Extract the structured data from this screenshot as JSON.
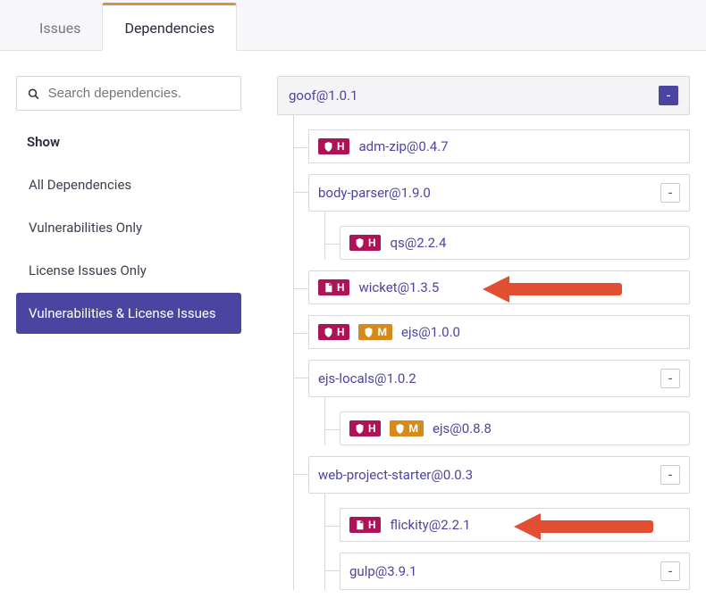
{
  "tabs": {
    "issues": "Issues",
    "dependencies": "Dependencies",
    "active": "dependencies"
  },
  "search": {
    "placeholder": "Search dependencies."
  },
  "filters": {
    "heading": "Show",
    "items": [
      {
        "id": "all",
        "label": "All Dependencies"
      },
      {
        "id": "vuln",
        "label": "Vulnerabilities Only"
      },
      {
        "id": "lic",
        "label": "License Issues Only"
      },
      {
        "id": "both",
        "label": "Vulnerabilities & License Issues"
      }
    ],
    "active": "both"
  },
  "tree": {
    "root": {
      "label": "goof@1.0.1",
      "collapse": "-"
    },
    "c": [
      {
        "label": "adm-zip@0.4.7",
        "badges": [
          {
            "icon": "shield",
            "sev": "H",
            "cls": "high"
          }
        ]
      },
      {
        "label": "body-parser@1.9.0",
        "collapse": "-",
        "c": [
          {
            "label": "qs@2.2.4",
            "badges": [
              {
                "icon": "shield",
                "sev": "H",
                "cls": "high"
              }
            ]
          }
        ]
      },
      {
        "label": "wicket@1.3.5",
        "arrow": true,
        "badges": [
          {
            "icon": "doc",
            "sev": "H",
            "cls": "high"
          }
        ]
      },
      {
        "label": "ejs@1.0.0",
        "badges": [
          {
            "icon": "shield",
            "sev": "H",
            "cls": "high"
          },
          {
            "icon": "shield",
            "sev": "M",
            "cls": "med"
          }
        ]
      },
      {
        "label": "ejs-locals@1.0.2",
        "collapse": "-",
        "c": [
          {
            "label": "ejs@0.8.8",
            "badges": [
              {
                "icon": "shield",
                "sev": "H",
                "cls": "high"
              },
              {
                "icon": "shield",
                "sev": "M",
                "cls": "med"
              }
            ]
          }
        ]
      },
      {
        "label": "web-project-starter@0.0.3",
        "collapse": "-",
        "c": [
          {
            "label": "flickity@2.2.1",
            "arrow": true,
            "badges": [
              {
                "icon": "doc",
                "sev": "H",
                "cls": "high"
              }
            ]
          },
          {
            "label": "gulp@3.9.1",
            "collapse": "-"
          }
        ]
      }
    ]
  }
}
